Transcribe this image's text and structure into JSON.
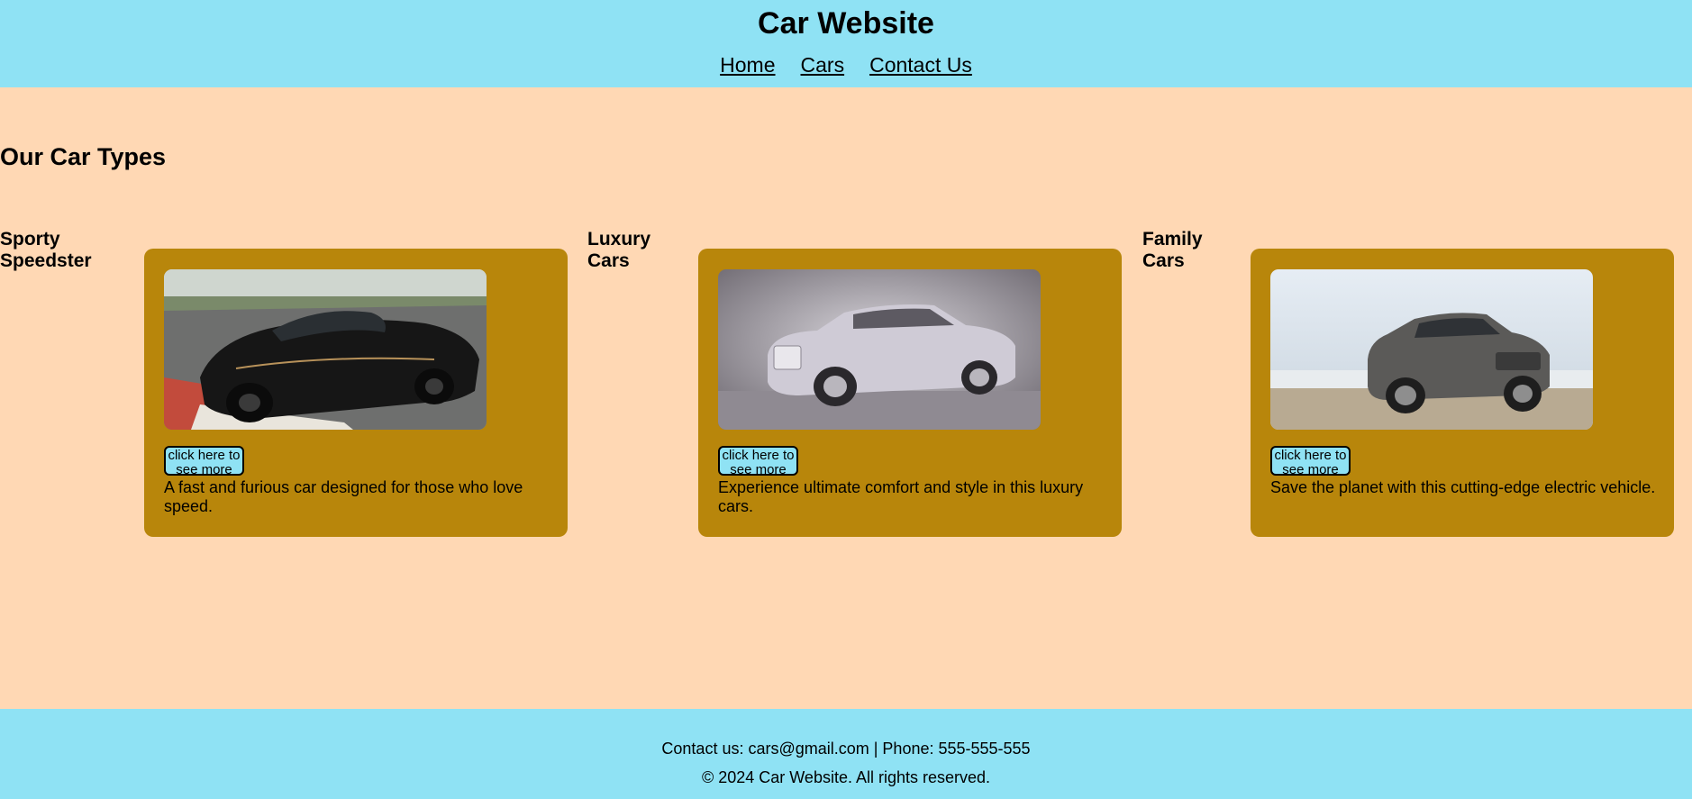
{
  "header": {
    "title": "Car Website",
    "nav": [
      "Home",
      "Cars",
      "Contact Us"
    ]
  },
  "main": {
    "section_title": "Our Car Types",
    "types": [
      {
        "label": "Sporty Speedster",
        "button": "click here to see more",
        "description": "A fast and furious car designed for those who love speed.",
        "image": "black-sports-car-photo"
      },
      {
        "label": "Luxury Cars",
        "button": "click here to see more",
        "description": "Experience ultimate comfort and style in this luxury cars.",
        "image": "silver-luxury-sedan-photo"
      },
      {
        "label": "Family Cars",
        "button": "click here to see more",
        "description": "Save the planet with this cutting-edge electric vehicle.",
        "image": "grey-suv-photo"
      }
    ]
  },
  "footer": {
    "contact": "Contact us: cars@gmail.com | Phone: 555-555-555",
    "copyright": "© 2024 Car Website. All rights reserved."
  },
  "colors": {
    "header_bg": "#8fe2f4",
    "page_bg": "#ffd8b4",
    "card_bg": "#b8860b",
    "button_bg": "#8fe2f4"
  }
}
